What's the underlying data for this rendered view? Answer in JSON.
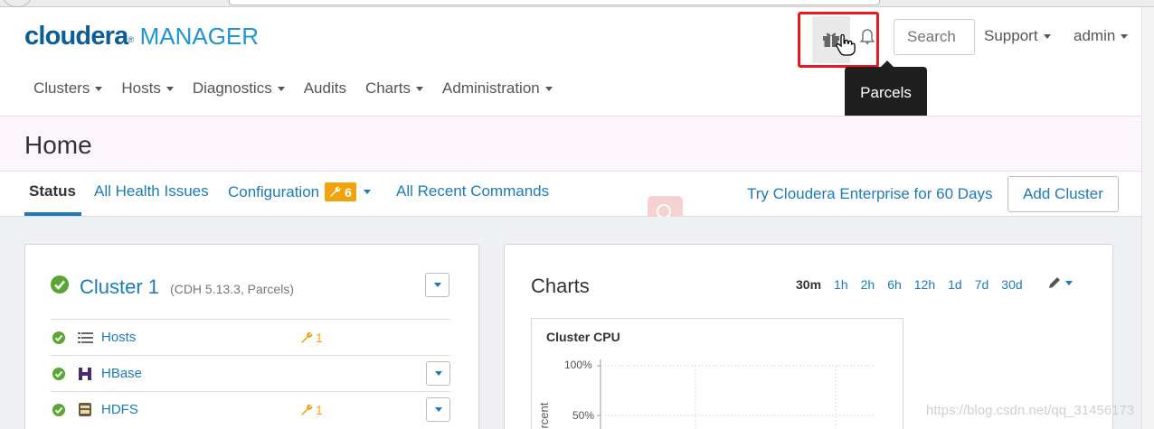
{
  "header": {
    "logo_main": "cloudera",
    "logo_reg": "®",
    "logo_sub": "MANAGER",
    "search_placeholder": "Search",
    "support_label": "Support",
    "admin_label": "admin",
    "tooltip": "Parcels"
  },
  "nav": {
    "items": [
      {
        "label": "Clusters",
        "dropdown": true
      },
      {
        "label": "Hosts",
        "dropdown": true
      },
      {
        "label": "Diagnostics",
        "dropdown": true
      },
      {
        "label": "Audits",
        "dropdown": false
      },
      {
        "label": "Charts",
        "dropdown": true
      },
      {
        "label": "Administration",
        "dropdown": true
      }
    ]
  },
  "page": {
    "title": "Home"
  },
  "tabs": {
    "status": "Status",
    "health": "All Health Issues",
    "config": "Configuration",
    "config_count": "6",
    "commands": "All Recent Commands",
    "trial": "Try Cloudera Enterprise for 60 Days",
    "add_cluster": "Add Cluster"
  },
  "cluster": {
    "name": "Cluster 1",
    "details": "(CDH 5.13.3, Parcels)",
    "services": [
      {
        "name": "Hosts",
        "config_issues": "1",
        "icon": "hosts-list-icon"
      },
      {
        "name": "HBase",
        "config_issues": "",
        "icon": "hbase-icon"
      },
      {
        "name": "HDFS",
        "config_issues": "1",
        "icon": "hdfs-icon"
      }
    ]
  },
  "charts": {
    "title": "Charts",
    "ranges": [
      "30m",
      "1h",
      "2h",
      "6h",
      "12h",
      "1d",
      "7d",
      "30d"
    ],
    "selected_range": "30m",
    "cpu_chart": {
      "title": "Cluster CPU",
      "y_ticks": [
        "100%",
        "50%"
      ],
      "y_axis_label": "percent"
    }
  },
  "watermark": "https://blog.csdn.net/qq_31456173",
  "colors": {
    "brand": "#0a5e95",
    "link": "#1c7bb8",
    "ok": "#5aa632",
    "warning": "#f0a30a",
    "highlight": "#e8181e"
  }
}
